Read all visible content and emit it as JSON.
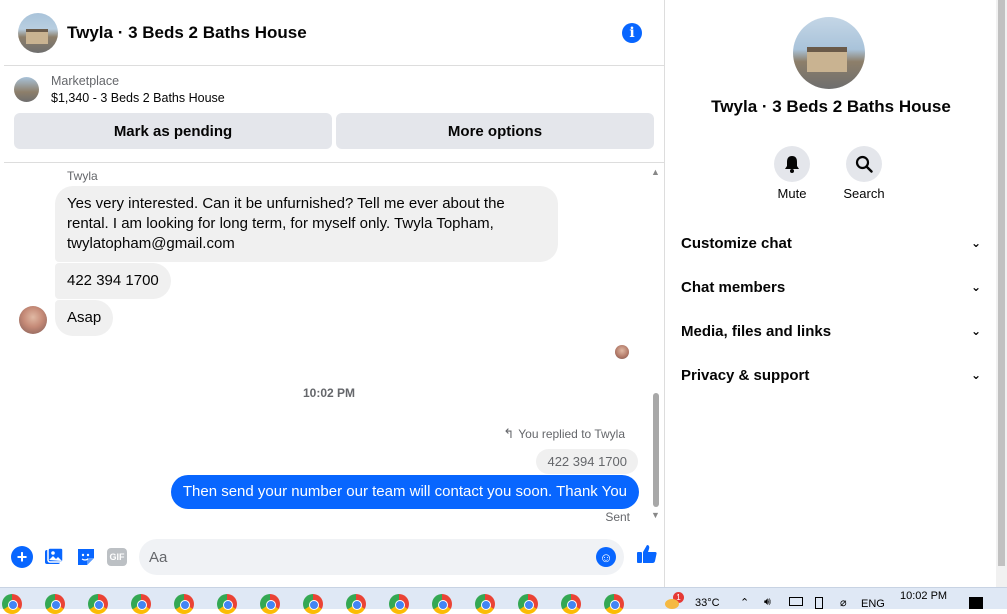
{
  "chat": {
    "title": "Twyla · 3 Beds 2 Baths House",
    "marketplace_label": "Marketplace",
    "listing": "$1,340 - 3 Beds 2 Baths House",
    "btn_pending": "Mark as pending",
    "btn_more": "More options",
    "sender_name": "Twyla",
    "messages": [
      "Yes very interested. Can it be unfurnished? Tell me ever about the rental. I am looking for long term, for myself only. Twyla Topham, twylatopham@gmail.com",
      "422 394 1700",
      "Asap"
    ],
    "timestamp": "10:02 PM",
    "replied_label": "You replied to Twyla",
    "quoted": "422 394 1700",
    "my_message": "Then send your number our team will contact you soon. Thank You",
    "status": "Sent",
    "composer_placeholder": "Aa",
    "gif_label": "GIF"
  },
  "info": {
    "title": "Twyla · 3 Beds 2 Baths House",
    "actions": [
      {
        "label": "Mute",
        "icon": "bell-icon"
      },
      {
        "label": "Search",
        "icon": "search-icon"
      }
    ],
    "sections": [
      "Customize chat",
      "Chat members",
      "Media, files and links",
      "Privacy & support"
    ]
  },
  "taskbar": {
    "temperature": "33°C",
    "language": "ENG",
    "clock": "10:02 PM",
    "notification_badge": "1"
  },
  "colors": {
    "accent": "#0866ff",
    "bubble_grey": "#f0f0f0",
    "button_grey": "#e4e6eb"
  }
}
